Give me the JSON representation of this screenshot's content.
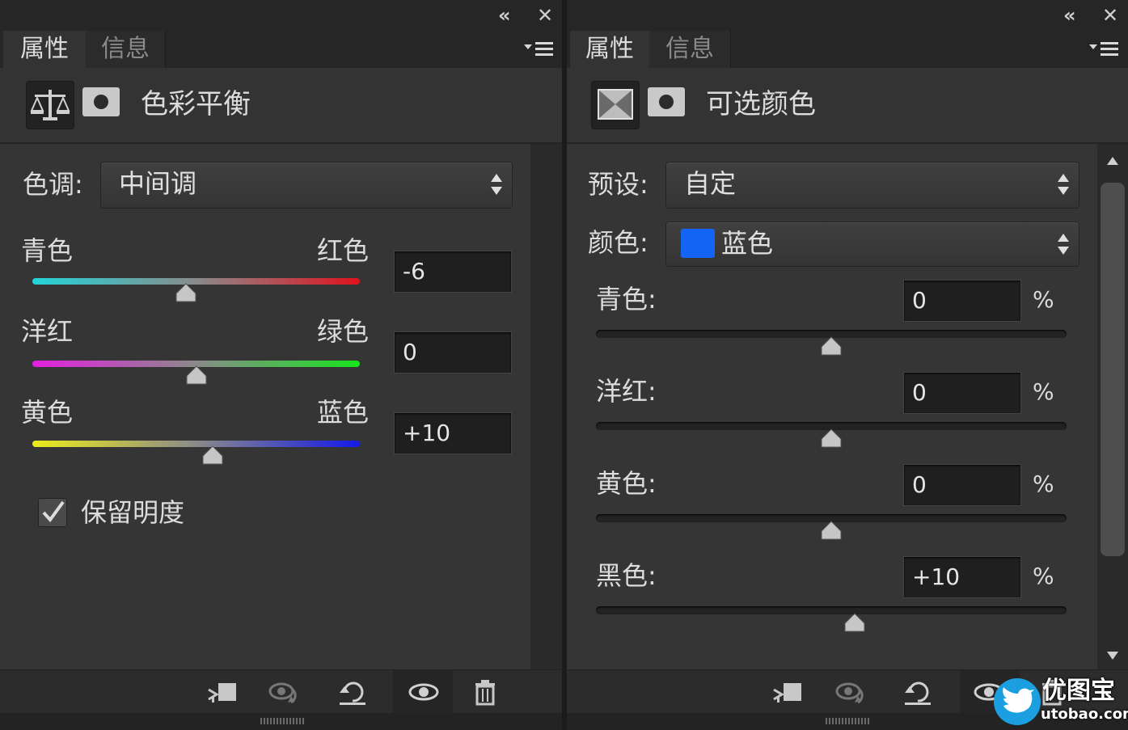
{
  "left_panel": {
    "titlebar": {
      "collapse_icon": "double-chevron-left-icon",
      "close_icon": "close-icon"
    },
    "tabs": [
      {
        "label": "属性",
        "active": true
      },
      {
        "label": "信息",
        "active": false
      }
    ],
    "menu_icon": "panel-menu-icon",
    "header": {
      "adjustment_icon": "balance-scale-icon",
      "mask_icon": "layer-mask-icon",
      "title": "色彩平衡"
    },
    "tone": {
      "label": "色调:",
      "value": "中间调"
    },
    "sliders": [
      {
        "left": "青色",
        "right": "红色",
        "value": "-6",
        "level": -6,
        "colors": [
          "#23d4d8",
          "#e0121e"
        ]
      },
      {
        "left": "洋红",
        "right": "绿色",
        "value": "0",
        "level": 0,
        "colors": [
          "#e51ee0",
          "#17e41e"
        ]
      },
      {
        "left": "黄色",
        "right": "蓝色",
        "value": "+10",
        "level": 10,
        "colors": [
          "#ecec1a",
          "#1419e8"
        ]
      }
    ],
    "preserve_luminosity": {
      "label": "保留明度",
      "checked": true
    },
    "footer_icons": [
      "clip-to-layer-icon",
      "view-previous-state-icon",
      "reset-icon",
      "visibility-eye-icon",
      "delete-trash-icon"
    ]
  },
  "right_panel": {
    "titlebar": {
      "collapse_icon": "double-chevron-left-icon",
      "close_icon": "close-icon"
    },
    "tabs": [
      {
        "label": "属性",
        "active": true
      },
      {
        "label": "信息",
        "active": false
      }
    ],
    "menu_icon": "panel-menu-icon",
    "header": {
      "adjustment_icon": "selective-color-icon",
      "mask_icon": "layer-mask-icon",
      "title": "可选颜色"
    },
    "preset": {
      "label": "预设:",
      "value": "自定"
    },
    "color": {
      "label": "颜色:",
      "value": "蓝色",
      "swatch": "#1464f5"
    },
    "sliders": [
      {
        "label": "青色:",
        "value": "0",
        "unit": "%",
        "level": 0
      },
      {
        "label": "洋红:",
        "value": "0",
        "unit": "%",
        "level": 0
      },
      {
        "label": "黄色:",
        "value": "0",
        "unit": "%",
        "level": 0
      },
      {
        "label": "黑色:",
        "value": "+10",
        "unit": "%",
        "level": 10
      }
    ],
    "footer_icons": [
      "clip-to-layer-icon",
      "view-previous-state-icon",
      "reset-icon",
      "visibility-eye-icon",
      "delete-trash-icon"
    ]
  },
  "watermark": {
    "title": "优图宝",
    "url": "utobao.com",
    "logo": "bird-logo-icon"
  }
}
